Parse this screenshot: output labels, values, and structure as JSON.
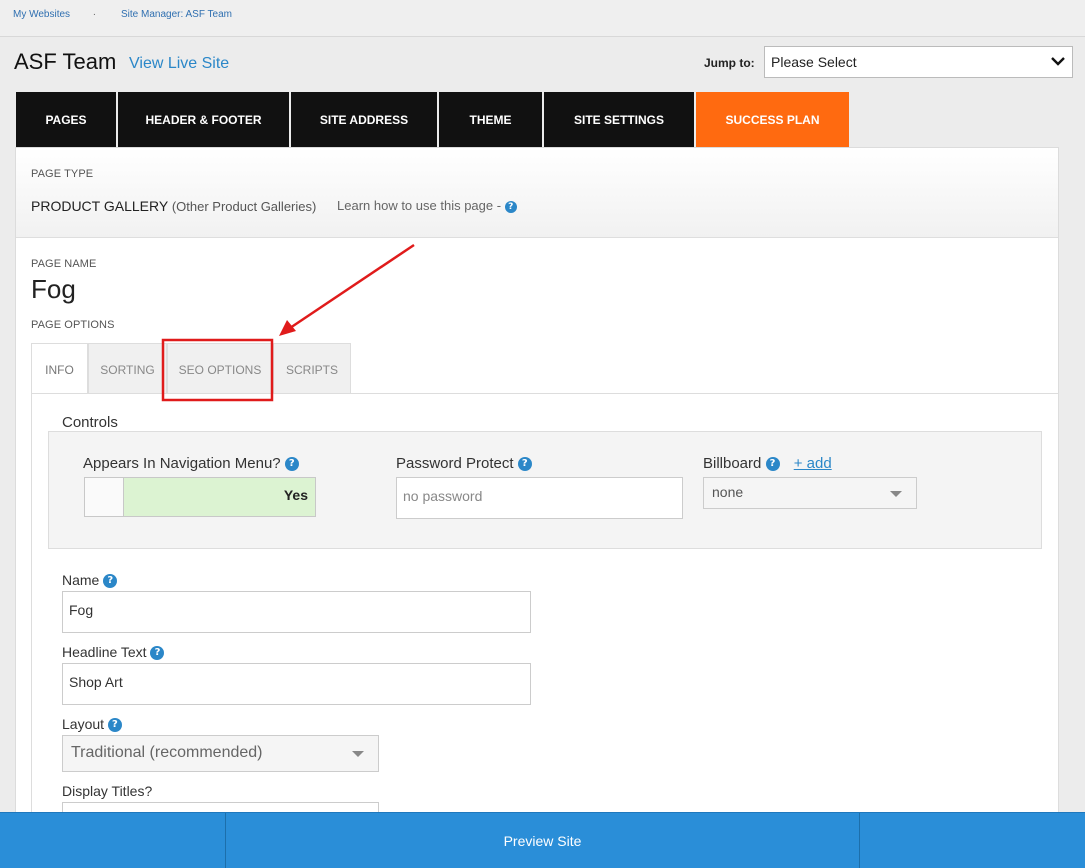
{
  "breadcrumb": {
    "my_websites": "My Websites",
    "separator": ".",
    "site_manager": "Site Manager: ASF Team"
  },
  "header": {
    "site_title": "ASF Team",
    "view_live": "View Live Site",
    "jump_label": "Jump to:",
    "jump_value": "Please Select"
  },
  "main_tabs": [
    {
      "label": "PAGES"
    },
    {
      "label": "HEADER & FOOTER"
    },
    {
      "label": "SITE ADDRESS"
    },
    {
      "label": "THEME"
    },
    {
      "label": "SITE SETTINGS"
    },
    {
      "label": "SUCCESS PLAN"
    }
  ],
  "page_type": {
    "label": "PAGE TYPE",
    "value": "PRODUCT GALLERY",
    "sub": "(Other Product Galleries)",
    "learn": "Learn how to use this page -"
  },
  "page_name": {
    "label": "PAGE NAME",
    "value": "Fog"
  },
  "page_options": {
    "label": "PAGE OPTIONS",
    "tabs": [
      {
        "label": "INFO"
      },
      {
        "label": "SORTING"
      },
      {
        "label": "SEO OPTIONS"
      },
      {
        "label": "SCRIPTS"
      }
    ]
  },
  "controls": {
    "label": "Controls",
    "nav_label": "Appears In Navigation Menu?",
    "nav_value": "Yes",
    "password_label": "Password Protect",
    "password_placeholder": "no password",
    "billboard_label": "Billboard",
    "billboard_add": "+ add",
    "billboard_value": "none"
  },
  "form": {
    "name_label": "Name",
    "name_value": "Fog",
    "headline_label": "Headline Text",
    "headline_value": "Shop Art",
    "layout_label": "Layout",
    "layout_value": "Traditional (recommended)",
    "display_titles_label": "Display Titles?"
  },
  "help_glyph": "?",
  "bottom": {
    "preview": "Preview Site"
  },
  "colors": {
    "accent": "#ff6a10",
    "link": "#2b87c8",
    "bottom_bar": "#2a8ed8",
    "annotation": "#e01b1b"
  }
}
